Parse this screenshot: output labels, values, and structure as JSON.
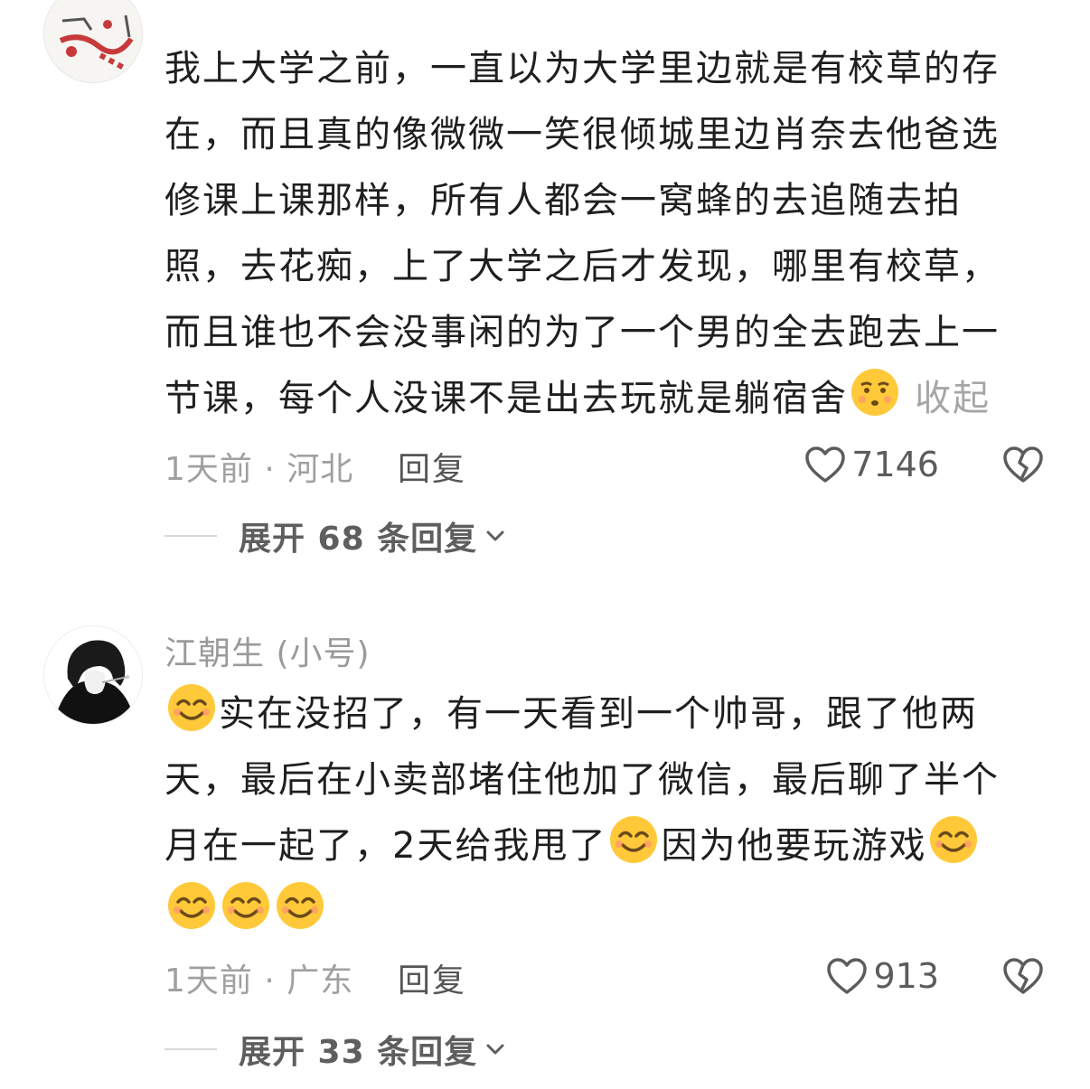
{
  "comments": [
    {
      "username": "",
      "text_lines": [
        "我上大学之前，一直以为大学里边就是有校草的存",
        "在，而且真的像微微一笑很倾城里边肖奈去他爸选",
        "修课上课那样，所有人都会一窝蜂的去追随去拍",
        "照，去花痴，上了大学之后才发现，哪里有校草，",
        "而且谁也不会没事闲的为了一个男的全去跑去上一",
        "节课，每个人没课不是出去玩就是躺宿舍"
      ],
      "emoji_end": "smirk-emoji",
      "collapse_label": "收起",
      "meta": "1天前 · 河北",
      "reply_label": "回复",
      "likes": "7146",
      "expand_label": "展开 68 条回复"
    },
    {
      "username": "江朝生 (小号)",
      "text_parts": {
        "line1": "实在没招了，有一天看到一个帅哥，跟了他两",
        "line2": "天，最后在小卖部堵住他加了微信，最后聊了半个",
        "line3a": "月在一起了，2天给我甩了",
        "line3b": "因为他要玩游戏"
      },
      "meta": "1天前 · 广东",
      "reply_label": "回复",
      "likes": "913",
      "expand_label": "展开 33 条回复"
    }
  ],
  "colors": {
    "text": "#1f1f1f",
    "muted": "#a0a0a0",
    "reply": "#555555",
    "emoji_face": "#ffc93a",
    "emoji_cheek": "#ff8a7a"
  }
}
